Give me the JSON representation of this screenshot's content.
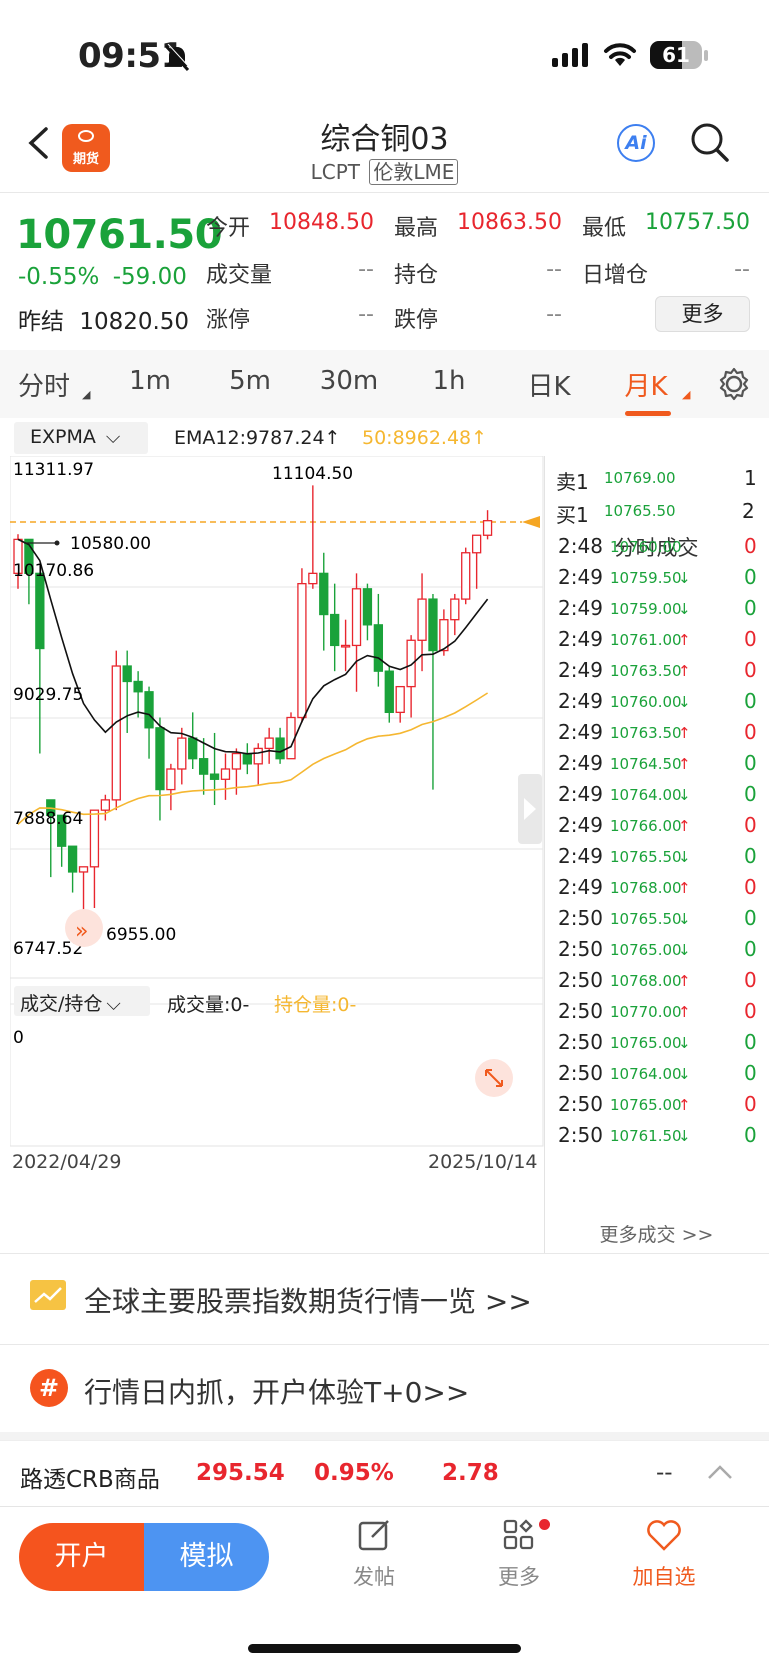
{
  "status": {
    "time": "09:51",
    "battery": "61"
  },
  "header": {
    "title": "综合铜03",
    "code": "LCPT",
    "exchange": "伦敦LME",
    "ai_label": "Ai",
    "logo_text": "期货"
  },
  "quote": {
    "last": "10761.50",
    "pct": "-0.55%",
    "change": "-59.00",
    "prev_label": "昨结",
    "prev": "10820.50",
    "fields": [
      {
        "label": "今开",
        "value": "10848.50",
        "color": "red"
      },
      {
        "label": "最高",
        "value": "10863.50",
        "color": "red"
      },
      {
        "label": "最低",
        "value": "10757.50",
        "color": "green"
      },
      {
        "label": "成交量",
        "value": "--",
        "color": "gray"
      },
      {
        "label": "持仓",
        "value": "--",
        "color": "gray"
      },
      {
        "label": "日增仓",
        "value": "--",
        "color": "gray"
      },
      {
        "label": "涨停",
        "value": "--",
        "color": "gray"
      },
      {
        "label": "跌停",
        "value": "--",
        "color": "gray"
      }
    ],
    "more": "更多"
  },
  "tabs": [
    "分时",
    "1m",
    "5m",
    "30m",
    "1h",
    "日K",
    "月K"
  ],
  "active_tab": "月K",
  "indicator": {
    "name": "EXPMA",
    "ema12": "EMA12:9787.24↑",
    "ema50": "50:8962.48↑"
  },
  "chart_labels": {
    "y_top": "11311.97",
    "y_mid1": "10170.86",
    "y_mid2": "9029.75",
    "y_mid3": "7888.64",
    "y_bottom": "6747.52",
    "high_note": "11104.50",
    "low_note": "6955.00",
    "marker_note": "10580.00",
    "date_start": "2022/04/29",
    "date_end": "2025/10/14"
  },
  "volume": {
    "selector": "成交/持仓",
    "vol_label": "成交量:0-",
    "oi_label": "持仓量:0-",
    "zero": "0"
  },
  "chart_data": {
    "type": "candlestick",
    "ylim": [
      6747.52,
      11311.97
    ],
    "candles": [
      [
        10250,
        10630,
        10100,
        10580
      ],
      [
        10580,
        10580,
        9950,
        10250
      ],
      [
        10250,
        10250,
        8500,
        9520
      ],
      [
        8050,
        8050,
        7300,
        7900
      ],
      [
        7900,
        7900,
        7400,
        7600
      ],
      [
        7600,
        7600,
        7150,
        7350
      ],
      [
        7350,
        7350,
        6955,
        7400
      ],
      [
        7400,
        7950,
        7000,
        7950
      ],
      [
        7950,
        8100,
        7850,
        8050
      ],
      [
        8050,
        9500,
        7950,
        9350
      ],
      [
        9350,
        9500,
        8700,
        9200
      ],
      [
        9200,
        9300,
        8850,
        9100
      ],
      [
        9100,
        9150,
        8450,
        8750
      ],
      [
        8750,
        8850,
        7850,
        8150
      ],
      [
        8150,
        8400,
        7950,
        8350
      ],
      [
        8350,
        8750,
        8200,
        8650
      ],
      [
        8650,
        8900,
        8350,
        8450
      ],
      [
        8450,
        8650,
        8100,
        8300
      ],
      [
        8300,
        8700,
        8000,
        8250
      ],
      [
        8250,
        8500,
        8050,
        8350
      ],
      [
        8350,
        8550,
        8100,
        8500
      ],
      [
        8500,
        8600,
        8300,
        8400
      ],
      [
        8400,
        8600,
        8200,
        8550
      ],
      [
        8550,
        8750,
        8400,
        8650
      ],
      [
        8650,
        8750,
        8400,
        8450
      ],
      [
        8450,
        8900,
        8450,
        8850
      ],
      [
        8850,
        10300,
        8800,
        10150
      ],
      [
        10150,
        11104.5,
        10100,
        10250
      ],
      [
        10250,
        10450,
        9500,
        9850
      ],
      [
        9850,
        10150,
        9300,
        9550
      ],
      [
        9550,
        9800,
        9300,
        9550
      ],
      [
        9550,
        10250,
        9100,
        10100
      ],
      [
        10100,
        10150,
        9600,
        9750
      ],
      [
        9750,
        10050,
        9150,
        9300
      ],
      [
        9300,
        9350,
        8800,
        8900
      ],
      [
        8900,
        9150,
        8800,
        9150
      ],
      [
        9150,
        9650,
        8850,
        9600
      ],
      [
        9600,
        10250,
        9300,
        10000
      ],
      [
        10000,
        10050,
        8150,
        9500
      ],
      [
        9500,
        9900,
        9450,
        9800
      ],
      [
        9800,
        10050,
        9650,
        10000
      ],
      [
        10000,
        10500,
        9950,
        10450
      ],
      [
        10450,
        10600,
        10100,
        10620
      ],
      [
        10620,
        10863.5,
        10580,
        10761.5
      ]
    ],
    "ema12_last": 9787.24,
    "ema50_last": 8962.48
  },
  "trades_panel": {
    "ask_label": "卖1",
    "ask_price": "10769.00",
    "ask_qty": "1",
    "bid_label": "买1",
    "bid_price": "10765.50",
    "bid_qty": "2",
    "title": "分时成交",
    "more": "更多成交 >>",
    "rows": [
      {
        "time": "2:48",
        "price": "10760.00",
        "arrow": "",
        "vol": "0",
        "vc": "red"
      },
      {
        "time": "2:49",
        "price": "10759.50",
        "arrow": "↓",
        "vol": "0",
        "vc": "green"
      },
      {
        "time": "2:49",
        "price": "10759.00",
        "arrow": "↓",
        "vol": "0",
        "vc": "green"
      },
      {
        "time": "2:49",
        "price": "10761.00",
        "arrow": "↑",
        "vol": "0",
        "vc": "red"
      },
      {
        "time": "2:49",
        "price": "10763.50",
        "arrow": "↑",
        "vol": "0",
        "vc": "red"
      },
      {
        "time": "2:49",
        "price": "10760.00",
        "arrow": "↓",
        "vol": "0",
        "vc": "green"
      },
      {
        "time": "2:49",
        "price": "10763.50",
        "arrow": "↑",
        "vol": "0",
        "vc": "red"
      },
      {
        "time": "2:49",
        "price": "10764.50",
        "arrow": "↑",
        "vol": "0",
        "vc": "green"
      },
      {
        "time": "2:49",
        "price": "10764.00",
        "arrow": "↓",
        "vol": "0",
        "vc": "green"
      },
      {
        "time": "2:49",
        "price": "10766.00",
        "arrow": "↑",
        "vol": "0",
        "vc": "red"
      },
      {
        "time": "2:49",
        "price": "10765.50",
        "arrow": "↓",
        "vol": "0",
        "vc": "green"
      },
      {
        "time": "2:49",
        "price": "10768.00",
        "arrow": "↑",
        "vol": "0",
        "vc": "red"
      },
      {
        "time": "2:50",
        "price": "10765.50",
        "arrow": "↓",
        "vol": "0",
        "vc": "green"
      },
      {
        "time": "2:50",
        "price": "10765.00",
        "arrow": "↓",
        "vol": "0",
        "vc": "green"
      },
      {
        "time": "2:50",
        "price": "10768.00",
        "arrow": "↑",
        "vol": "0",
        "vc": "red"
      },
      {
        "time": "2:50",
        "price": "10770.00",
        "arrow": "↑",
        "vol": "0",
        "vc": "red"
      },
      {
        "time": "2:50",
        "price": "10765.00",
        "arrow": "↓",
        "vol": "0",
        "vc": "green"
      },
      {
        "time": "2:50",
        "price": "10764.00",
        "arrow": "↓",
        "vol": "0",
        "vc": "green"
      },
      {
        "time": "2:50",
        "price": "10765.00",
        "arrow": "↑",
        "vol": "0",
        "vc": "red"
      },
      {
        "time": "2:50",
        "price": "10761.50",
        "arrow": "↓",
        "vol": "0",
        "vc": "green"
      }
    ]
  },
  "links": [
    {
      "text": "全球主要股票指数期货行情一览 >>"
    },
    {
      "text": "行情日内抓，开户体验T+0>>"
    }
  ],
  "crb": {
    "name": "路透CRB商品",
    "value": "295.54",
    "pct": "0.95%",
    "change": "2.78",
    "extra": "--"
  },
  "tabbar": {
    "open": "开户",
    "sim": "模拟",
    "post": "发帖",
    "more": "更多",
    "watch": "加自选"
  },
  "colors": {
    "red": "#e8262e",
    "green": "#1aa23a",
    "orange": "#f05a1e",
    "blue": "#4d94f2",
    "ema50": "#f5b731"
  }
}
